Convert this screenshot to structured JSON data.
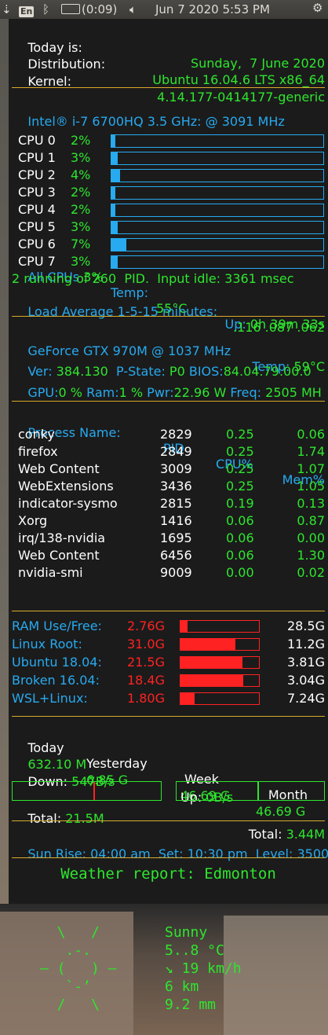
{
  "topbar": {
    "keyboard_layout": "En",
    "battery_time": "(0:09)",
    "datetime": "Jun  7 2020  5:53 PM"
  },
  "system": {
    "today_label": "Today is:",
    "today_value": "Sunday,  7 June 2020",
    "distro_label": "Distribution:",
    "distro_value": "Ubuntu 16.04.6 LTS x86_64",
    "kernel_label": "Kernel:",
    "kernel_value": "4.14.177-0414177-generic"
  },
  "cpu": {
    "header_label": "Intel® i-7 6700HQ 3.5 GHz: @",
    "header_freq": "3091 MHz",
    "cores": [
      {
        "name": "CPU 0",
        "pct": "2%",
        "value": 2
      },
      {
        "name": "CPU 1",
        "pct": "3%",
        "value": 3
      },
      {
        "name": "CPU 2",
        "pct": "4%",
        "value": 4
      },
      {
        "name": "CPU 3",
        "pct": "2%",
        "value": 2
      },
      {
        "name": "CPU 4",
        "pct": "2%",
        "value": 2
      },
      {
        "name": "CPU 5",
        "pct": "3%",
        "value": 3
      },
      {
        "name": "CPU 6",
        "pct": "7%",
        "value": 7
      },
      {
        "name": "CPU 7",
        "pct": "3%",
        "value": 3
      }
    ],
    "all_label": "All CPUs",
    "all_value": "3%",
    "temp_label": "Temp:",
    "temp_value": "55°C",
    "uptime_label": "Up:",
    "uptime_value": "0h 39m 33s",
    "running_line": "2 running of 260  PID.  Input idle: 3361 msec",
    "load_label": "Load Average 1-5-15 minutes:",
    "load_value": ".116 .087 .062"
  },
  "gpu": {
    "name": "GeForce GTX 970M @ 1037 MHz",
    "temp_label": "Temp:",
    "temp_value": "59°C",
    "ver_label": "Ver:",
    "ver_value": "384.130",
    "pstate_label": "P-State:",
    "pstate_value": "P0",
    "bios_label": "BIOS:",
    "bios_value": "84.04.79.00.0",
    "gpu_label": "GPU:",
    "gpu_value": "0 %",
    "ram_label": "Ram:",
    "ram_value": "1 %",
    "pwr_label": "Pwr:",
    "pwr_value": "22.96 W",
    "freq_label": "Freq:",
    "freq_value": "2505 MH"
  },
  "processes": {
    "headers": [
      "Process Name:",
      "PID",
      "CPU%",
      "Mem%"
    ],
    "rows": [
      [
        "conky",
        "2829",
        "0.25",
        "0.06"
      ],
      [
        "firefox",
        "2849",
        "0.25",
        "1.74"
      ],
      [
        "Web Content",
        "3009",
        "0.25",
        "1.07"
      ],
      [
        "WebExtensions",
        "3436",
        "0.25",
        "1.05"
      ],
      [
        "indicator-sysmo",
        "2815",
        "0.19",
        "0.13"
      ],
      [
        "Xorg",
        "1416",
        "0.06",
        "0.87"
      ],
      [
        "irq/138-nvidia",
        "1695",
        "0.06",
        "0.00"
      ],
      [
        "Web Content",
        "6456",
        "0.06",
        "1.30"
      ],
      [
        "nvidia-smi",
        "9009",
        "0.00",
        "0.02"
      ]
    ]
  },
  "storage": [
    {
      "label": "RAM Use/Free:",
      "used": "2.76G",
      "free": "28.5G",
      "fill": 0.088
    },
    {
      "label": "Linux Root:",
      "used": "31.0G",
      "free": "11.2G",
      "fill": 0.7
    },
    {
      "label": "Ubuntu 18.04:",
      "used": "21.5G",
      "free": "3.81G",
      "fill": 0.79
    },
    {
      "label": "Broken 16.04:",
      "used": "18.4G",
      "free": "3.04G",
      "fill": 0.8
    },
    {
      "label": "WSL+Linux:",
      "used": "1.80G",
      "free": "7.24G",
      "fill": 0.18
    }
  ],
  "network": {
    "col_today": "Today",
    "col_yesterday": "Yesterday",
    "col_week": "Week",
    "col_month": "Month",
    "val_today": "632.10 M",
    "val_yesterday": "6.85 G",
    "val_week": "46.69 G",
    "val_month": "46.69 G",
    "down_label": "Down:",
    "down_value": "547B/s",
    "up_label": "Up:",
    "up_value": "0B/s",
    "total_label": "Total:",
    "total_down": "21.5M",
    "total_up": "3.44M"
  },
  "sun": {
    "rise_label": "Sun Rise:",
    "rise_value": "04:00 am",
    "set_label": "Set:",
    "set_value": "10:30 pm",
    "level_label": "Level:",
    "level_value": "3500"
  },
  "weather": {
    "title": "Weather report: Edmonton",
    "art": [
      "  \\   /  ",
      "   .-.   ",
      "― (   ) ―",
      "   `-’   ",
      "  /   \\  "
    ],
    "lines": [
      "Sunny",
      "5..8 °C",
      "↘ 19 km/h",
      "6 km",
      "9.2 mm"
    ]
  },
  "colors": {
    "white": "#ffffff",
    "green": "#2ee62e",
    "blue": "#27aaf0",
    "red": "#ff2222",
    "separator": "#d9aa2a"
  }
}
